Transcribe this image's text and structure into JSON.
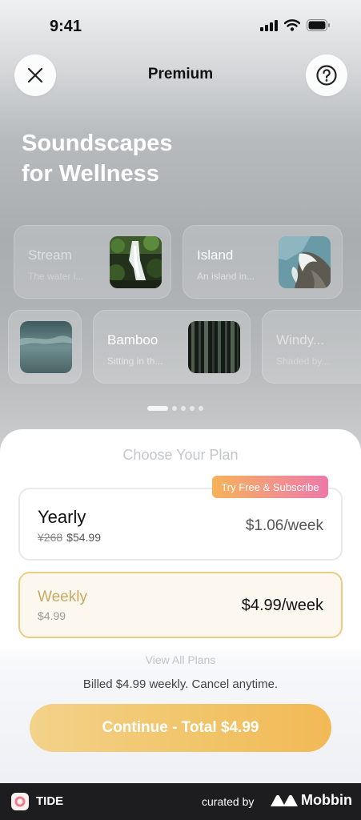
{
  "status_bar": {
    "time": "9:41"
  },
  "nav": {
    "title": "Premium"
  },
  "hero": {
    "title_line1": "Soundscapes",
    "title_line2": "for Wellness"
  },
  "cards_row1": [
    {
      "name": "Stream",
      "subtitle": "The water i...",
      "image": "waterfall-forest"
    },
    {
      "name": "Island",
      "subtitle": "An island in...",
      "image": "aerial-coast"
    }
  ],
  "cards_row2": [
    {
      "name": "",
      "subtitle": "",
      "image": "underwater"
    },
    {
      "name": "Bamboo",
      "subtitle": "Sitting in th...",
      "image": "bamboo-forest"
    },
    {
      "name": "Windy...",
      "subtitle": "Shaded by...",
      "image": ""
    }
  ],
  "pager": {
    "count": 5,
    "active": 0
  },
  "plans": {
    "heading": "Choose Your Plan",
    "badge": "Try Free & Subscribe",
    "yearly": {
      "name": "Yearly",
      "original_price": "¥268",
      "price": "$54.99",
      "per_week": "$1.06/week"
    },
    "weekly": {
      "name": "Weekly",
      "price": "$4.99",
      "per_week": "$4.99/week",
      "selected": true
    },
    "view_all": "View All Plans",
    "billing_note": "Billed $4.99 weekly. Cancel anytime.",
    "continue_label": "Continue - Total $4.99"
  },
  "footer": {
    "app_name": "TIDE",
    "curated_by": "curated by",
    "brand": "Mobbin"
  },
  "colors": {
    "accent_gold": "#e9cd82",
    "weekly_text": "#c9a961",
    "badge_gradient_start": "#f6b258",
    "badge_gradient_end": "#ec7aa9",
    "button_gradient": "#f2c766"
  }
}
